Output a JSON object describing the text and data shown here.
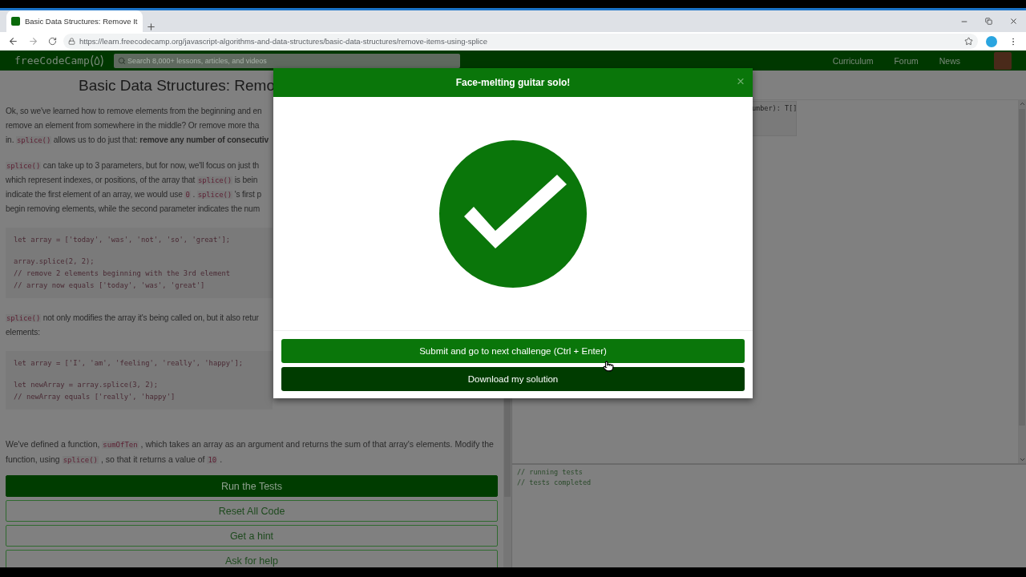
{
  "browser": {
    "tab": {
      "title": "Basic Data Structures: Remove It",
      "selected": true
    },
    "url": "https://learn.freecodecamp.org/javascript-algorithms-and-data-structures/basic-data-structures/remove-items-using-splice"
  },
  "nav": {
    "logo": "freeCodeCamp",
    "search": {
      "placeholder": "Search 8,000+ lessons, articles, and videos"
    },
    "links": [
      "Curriculum",
      "Forum",
      "News"
    ]
  },
  "lesson": {
    "title": "Basic Data Structures: Remo",
    "blocks": [
      {
        "kind": "para",
        "lines": [
          [
            {
              "kind": "text",
              "text": "Ok, so we've learned how to remove elements from the beginning and en"
            }
          ],
          [
            {
              "kind": "text",
              "text": "remove an element from somewhere in the middle? Or remove more tha"
            }
          ],
          [
            {
              "kind": "text",
              "text": "in. "
            },
            {
              "kind": "code",
              "text": "splice()"
            },
            {
              "kind": "text",
              "text": " allows us to do just that: "
            },
            {
              "kind": "bold",
              "text": "remove any number of consecutiv"
            }
          ]
        ]
      },
      {
        "kind": "para",
        "lines": [
          [
            {
              "kind": "code",
              "text": "splice()"
            },
            {
              "kind": "text",
              "text": " can take up to 3 parameters, but for now, we'll focus on just th"
            }
          ],
          [
            {
              "kind": "text",
              "text": "which represent indexes, or positions, of the array that "
            },
            {
              "kind": "code",
              "text": "splice()"
            },
            {
              "kind": "text",
              "text": " is bein"
            }
          ],
          [
            {
              "kind": "text",
              "text": "indicate the first element of an array, we would use "
            },
            {
              "kind": "code",
              "text": "0"
            },
            {
              "kind": "text",
              "text": " . "
            },
            {
              "kind": "code",
              "text": "splice()"
            },
            {
              "kind": "text",
              "text": " 's first p"
            }
          ],
          [
            {
              "kind": "text",
              "text": "begin removing elements, while the second parameter indicates the num"
            }
          ]
        ]
      },
      {
        "kind": "code",
        "groups": [
          [
            "let array = ['today', 'was', 'not', 'so', 'great'];"
          ],
          [
            "array.splice(2, 2);",
            "// remove 2 elements beginning with the 3rd element",
            "// array now equals ['today', 'was', 'great']"
          ]
        ]
      },
      {
        "kind": "para",
        "lines": [
          [
            {
              "kind": "code",
              "text": "splice()"
            },
            {
              "kind": "text",
              "text": " not only modifies the array it's being called on, but it also retur"
            }
          ],
          [
            {
              "kind": "text",
              "text": "elements:"
            }
          ]
        ]
      },
      {
        "kind": "code",
        "groups": [
          [
            "let array = ['I', 'am', 'feeling', 'really', 'happy'];"
          ],
          [
            "let newArray = array.splice(3, 2);",
            "// newArray equals ['really', 'happy']"
          ]
        ]
      }
    ],
    "task": [
      {
        "kind": "text",
        "text": "We've defined a function, "
      },
      {
        "kind": "code",
        "text": "sumOfTen"
      },
      {
        "kind": "text",
        "text": " , which takes an array as an argument and returns the sum of that array's elements. Modify the function, using "
      },
      {
        "kind": "code",
        "text": "splice()"
      },
      {
        "kind": "text",
        "text": " , so that it returns a value of "
      },
      {
        "kind": "code",
        "text": "10"
      },
      {
        "kind": "text",
        "text": " ."
      }
    ],
    "buttons": [
      {
        "label": "Run the Tests",
        "kind": "primary"
      },
      {
        "label": "Reset All Code",
        "kind": "outline"
      },
      {
        "label": "Get a hint",
        "kind": "outline"
      },
      {
        "label": "Ask for help",
        "kind": "outline"
      }
    ]
  },
  "editor": {
    "hint": "umber): T[]",
    "console": [
      "// running tests",
      "// tests completed"
    ]
  },
  "modal": {
    "title": "Face-melting guitar solo!",
    "close": "×",
    "buttons": [
      {
        "label": "Submit and go to next challenge (Ctrl + Enter)",
        "kind": "submit"
      },
      {
        "label": "Download my solution",
        "kind": "download"
      }
    ]
  }
}
